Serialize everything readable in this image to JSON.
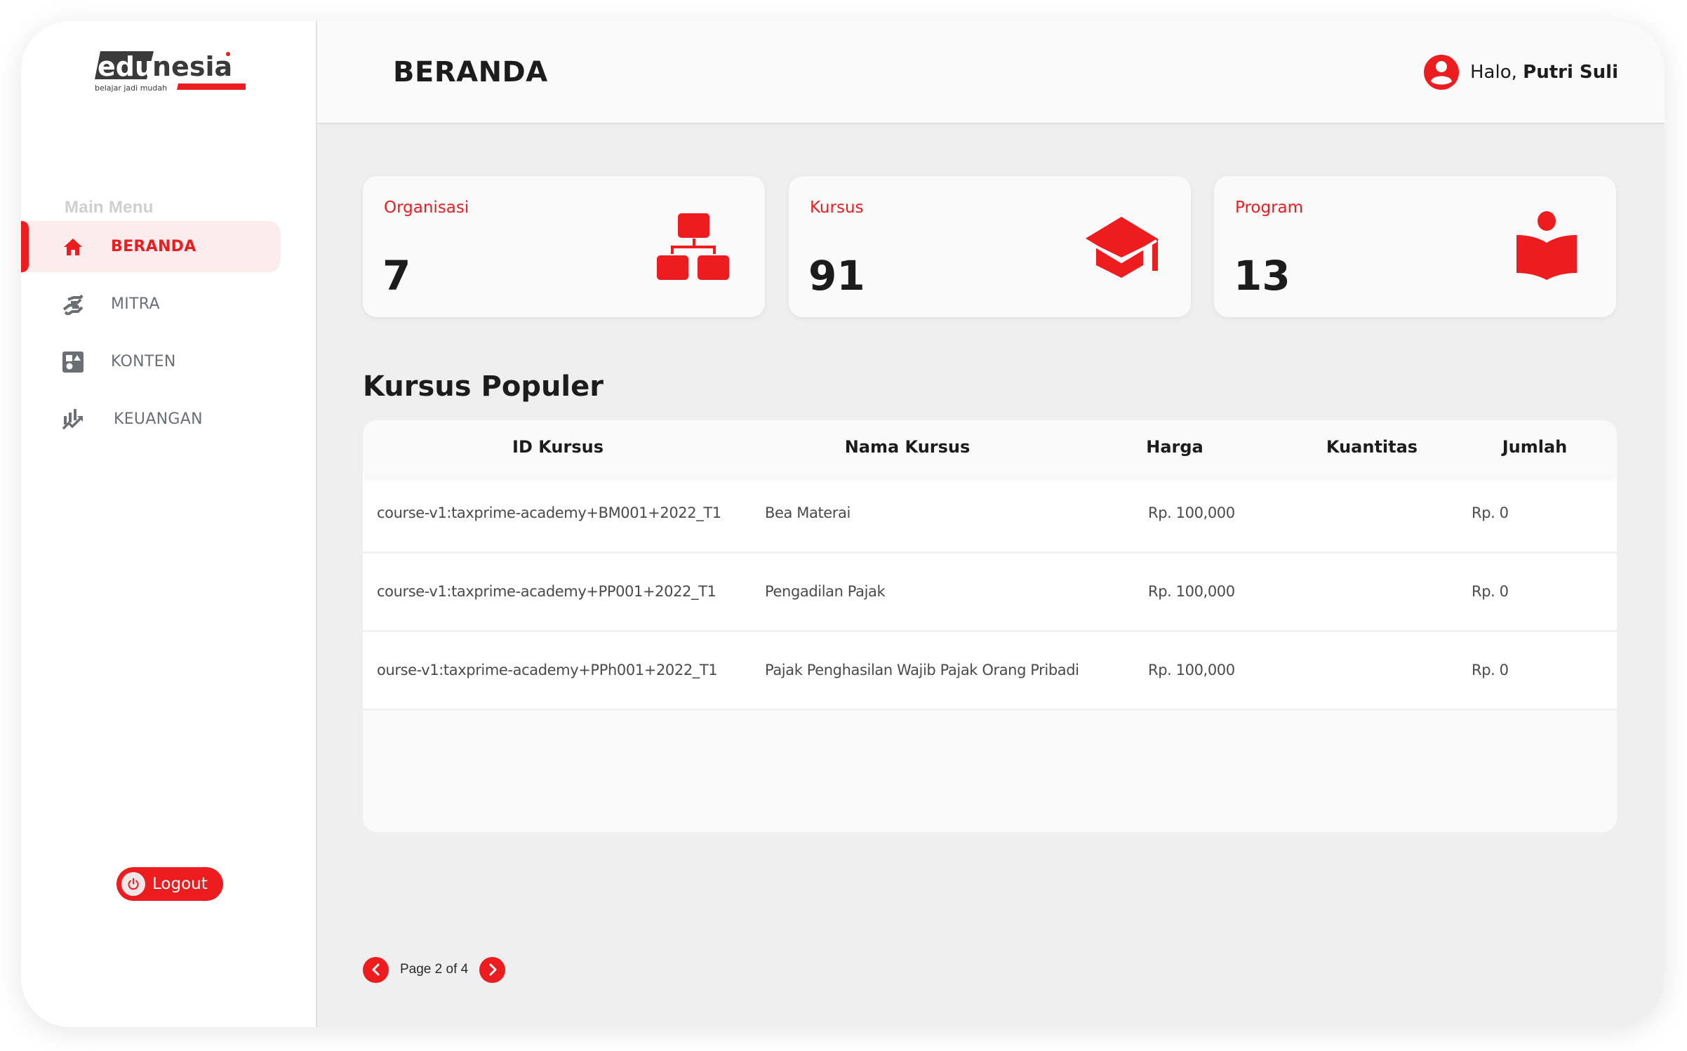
{
  "brand": {
    "logo_dark": "edu",
    "logo_light": "nesia",
    "tagline": "belajar jadi mudah",
    "accent_color": "#ed1c1f"
  },
  "sidebar": {
    "section_label": "Main Menu",
    "items": [
      {
        "label": "BERANDA",
        "icon": "home-icon",
        "active": true
      },
      {
        "label": "MITRA",
        "icon": "handshake-icon",
        "active": false
      },
      {
        "label": "KONTEN",
        "icon": "content-shapes-icon",
        "active": false
      },
      {
        "label": "KEUANGAN",
        "icon": "finance-chart-icon",
        "active": false
      }
    ],
    "logout_label": "Logout"
  },
  "header": {
    "title": "BERANDA",
    "greeting_prefix": "Halo,",
    "user_name": "Putri Suli"
  },
  "stats": [
    {
      "label": "Organisasi",
      "value": "7",
      "icon": "org-chart-icon"
    },
    {
      "label": "Kursus",
      "value": "91",
      "icon": "graduation-cap-icon"
    },
    {
      "label": "Program",
      "value": "13",
      "icon": "reading-book-icon"
    }
  ],
  "popular": {
    "title": "Kursus Populer",
    "columns": [
      "ID Kursus",
      "Nama Kursus",
      "Harga",
      "Kuantitas",
      "Jumlah"
    ],
    "rows": [
      {
        "id": "course-v1:taxprime-academy+BM001+2022_T1",
        "name": "Bea Materai",
        "price": "Rp. 100,000",
        "qty": "",
        "total": "Rp. 0"
      },
      {
        "id": "course-v1:taxprime-academy+PP001+2022_T1",
        "name": "Pengadilan Pajak",
        "price": "Rp. 100,000",
        "qty": "",
        "total": "Rp. 0"
      },
      {
        "id": "ourse-v1:taxprime-academy+PPh001+2022_T1",
        "name": "Pajak Penghasilan Wajib Pajak Orang Pribadi",
        "price": "Rp. 100,000",
        "qty": "",
        "total": "Rp. 0"
      }
    ]
  },
  "pagination": {
    "text": "Page 2 of 4",
    "current": 2,
    "total": 4
  }
}
